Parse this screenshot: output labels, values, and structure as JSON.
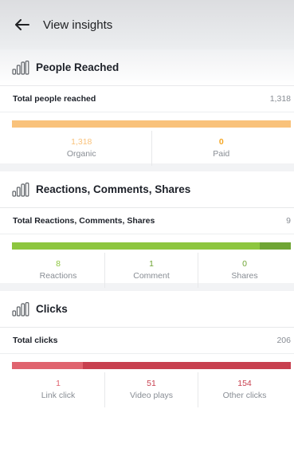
{
  "header": {
    "title": "View insights"
  },
  "colors": {
    "organic": "#f9c27b",
    "paid": "#f5a623",
    "rcs_main": "#8dc63f",
    "rcs_dark": "#6fa534",
    "clicks_light": "#e0636e",
    "clicks_dark": "#c8404f"
  },
  "people_reached": {
    "title": "People Reached",
    "total_label": "Total people reached",
    "total_value": "1,318",
    "stats": [
      {
        "value": "1,318",
        "label": "Organic",
        "fraction": 1.0
      },
      {
        "value": "0",
        "label": "Paid",
        "fraction": 0.0
      }
    ]
  },
  "reactions": {
    "title": "Reactions, Comments, Shares",
    "total_label": "Total Reactions, Comments, Shares",
    "total_value": "9",
    "stats": [
      {
        "value": "8",
        "label": "Reactions",
        "fraction": 0.889
      },
      {
        "value": "1",
        "label": "Comment",
        "fraction": 0.111
      },
      {
        "value": "0",
        "label": "Shares",
        "fraction": 0.0
      }
    ]
  },
  "clicks": {
    "title": "Clicks",
    "total_label": "Total clicks",
    "total_value": "206",
    "stats": [
      {
        "value": "1",
        "label": "Link click",
        "fraction": 0.005
      },
      {
        "value": "51",
        "label": "Video plays",
        "fraction": 0.248
      },
      {
        "value": "154",
        "label": "Other clicks",
        "fraction": 0.747
      }
    ]
  }
}
